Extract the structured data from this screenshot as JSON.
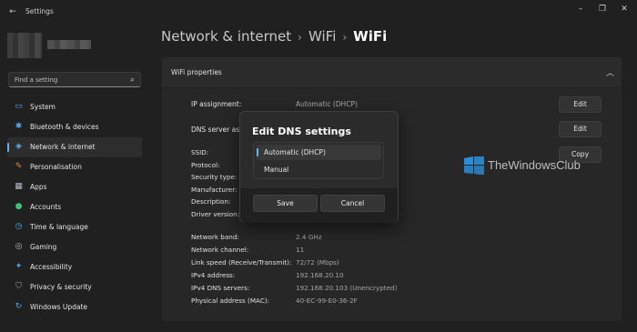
{
  "window": {
    "title": "Settings",
    "back_icon": "back-arrow-icon",
    "minimize_icon": "minimize-icon",
    "maximize_icon": "maximize-icon",
    "close_icon": "close-icon"
  },
  "sidebar": {
    "search_placeholder": "Find a setting",
    "items": [
      {
        "label": "System",
        "icon": "monitor-icon",
        "color": "#4aa8f0"
      },
      {
        "label": "Bluetooth & devices",
        "icon": "bluetooth-icon",
        "color": "#4aa8f0"
      },
      {
        "label": "Network & internet",
        "icon": "wifi-icon",
        "color": "#5fb2f2",
        "active": true
      },
      {
        "label": "Personalisation",
        "icon": "brush-icon",
        "color": "#e08a3c"
      },
      {
        "label": "Apps",
        "icon": "apps-icon",
        "color": "#b9b9c8"
      },
      {
        "label": "Accounts",
        "icon": "person-icon",
        "color": "#3cc07a"
      },
      {
        "label": "Time & language",
        "icon": "globe-clock-icon",
        "color": "#4aa8f0"
      },
      {
        "label": "Gaming",
        "icon": "gamepad-icon",
        "color": "#b9b9c8"
      },
      {
        "label": "Accessibility",
        "icon": "accessibility-icon",
        "color": "#4aa8f0"
      },
      {
        "label": "Privacy & security",
        "icon": "shield-icon",
        "color": "#a0a0a0"
      },
      {
        "label": "Windows Update",
        "icon": "update-icon",
        "color": "#4aa8f0"
      }
    ]
  },
  "header": {
    "crumb1": "Network & internet",
    "crumb2": "WiFi",
    "crumb3": "WiFi",
    "separator": "›"
  },
  "card": {
    "title": "WiFi properties",
    "rows": [
      {
        "label": "IP assignment:",
        "value": "Automatic (DHCP)",
        "button": "Edit"
      },
      {
        "label": "DNS server assi",
        "value": "",
        "button": "Edit"
      }
    ],
    "ssid_block": [
      {
        "label": "SSID:",
        "button": "Copy"
      },
      {
        "label": "Protocol:"
      },
      {
        "label": "Security type:"
      },
      {
        "label": "Manufacturer:"
      },
      {
        "label": "Description:"
      },
      {
        "label": "Driver version:"
      }
    ],
    "details": [
      {
        "label": "Network band:",
        "value": "2.4 GHz"
      },
      {
        "label": "Network channel:",
        "value": "11"
      },
      {
        "label": "Link speed (Receive/Transmit):",
        "value": "72/72 (Mbps)"
      },
      {
        "label": "IPv4 address:",
        "value": "192.168.20.10"
      },
      {
        "label": "IPv4 DNS servers:",
        "value": "192.168.20.103 (Unencrypted)"
      },
      {
        "label": "Physical address (MAC):",
        "value": "40-EC-99-E0-36-2F"
      }
    ]
  },
  "dialog": {
    "title": "Edit DNS settings",
    "options": [
      "Automatic (DHCP)",
      "Manual"
    ],
    "selected": "Automatic (DHCP)",
    "save_label": "Save",
    "cancel_label": "Cancel"
  },
  "watermark": {
    "text": "TheWindowsClub"
  }
}
